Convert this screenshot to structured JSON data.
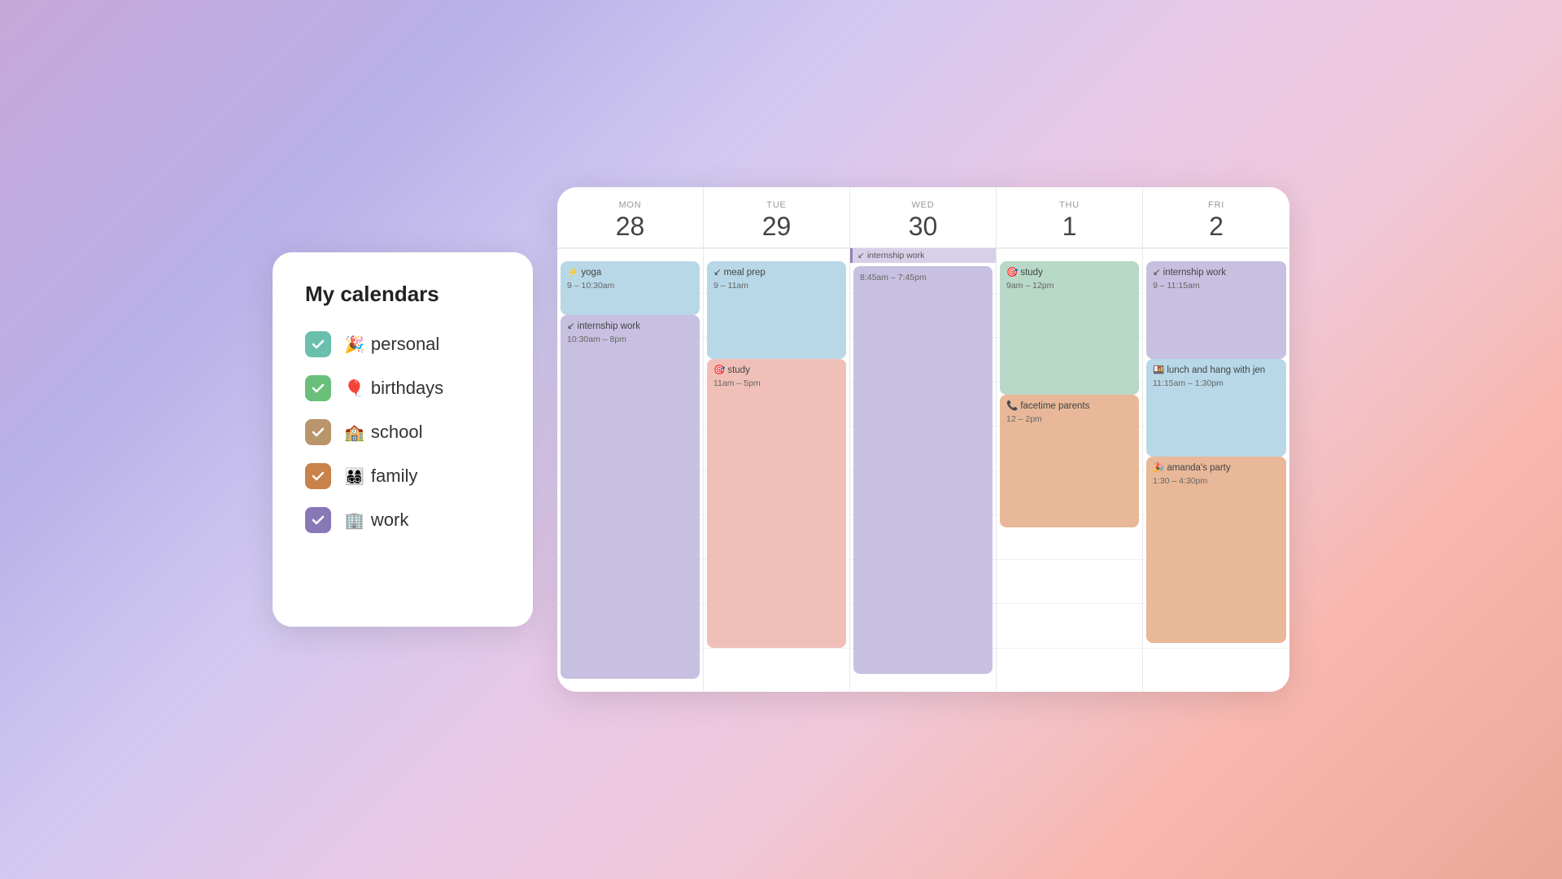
{
  "sidebar": {
    "title": "My calendars",
    "items": [
      {
        "id": "personal",
        "label": "personal",
        "emoji": "🎉",
        "color_class": "checkbox-teal",
        "checked": true
      },
      {
        "id": "birthdays",
        "label": "birthdays",
        "emoji": "🎈",
        "color_class": "checkbox-green",
        "checked": true
      },
      {
        "id": "school",
        "label": "school",
        "emoji": "🏫",
        "color_class": "checkbox-tan",
        "checked": true
      },
      {
        "id": "family",
        "label": "family",
        "emoji": "👨‍👩‍👧‍👦",
        "color_class": "checkbox-orange",
        "checked": true
      },
      {
        "id": "work",
        "label": "work",
        "emoji": "🏢",
        "color_class": "checkbox-purple",
        "checked": true
      }
    ]
  },
  "calendar": {
    "days": [
      {
        "name": "MON",
        "number": "28"
      },
      {
        "name": "TUE",
        "number": "29"
      },
      {
        "name": "WED",
        "number": "30"
      },
      {
        "name": "THU",
        "number": "1"
      },
      {
        "name": "FRI",
        "number": "2"
      }
    ],
    "events": {
      "mon": [
        {
          "title": "yoga",
          "emoji": "⚡",
          "time": "9 – 10:30am",
          "color": "event-blue",
          "top_pct": 3,
          "height_pct": 12
        },
        {
          "title": "internship work",
          "emoji": "↙",
          "time": "10:30am – 8pm",
          "color": "event-purple",
          "top_pct": 15,
          "height_pct": 82
        }
      ],
      "tue": [
        {
          "title": "meal prep",
          "emoji": "↙",
          "time": "9 – 11am",
          "color": "event-blue",
          "top_pct": 3,
          "height_pct": 22
        },
        {
          "title": "study",
          "emoji": "🎯",
          "time": "11am – 5pm",
          "color": "event-pink",
          "top_pct": 25,
          "height_pct": 65
        }
      ],
      "wed": [
        {
          "title": "internship work",
          "emoji": "↙",
          "time": "8:45am – 7:45pm",
          "color": "event-purple",
          "top_pct": 1,
          "height_pct": 96,
          "is_banner": true,
          "banner_text": "internship work",
          "banner_subtext": "8:45am – 7:45pm"
        }
      ],
      "thu": [
        {
          "title": "study",
          "emoji": "🎯",
          "time": "9am – 12pm",
          "color": "event-green",
          "top_pct": 3,
          "height_pct": 30
        },
        {
          "title": "facetime parents",
          "emoji": "📞",
          "time": "12 – 2pm",
          "color": "event-orange",
          "top_pct": 33,
          "height_pct": 30
        }
      ],
      "fri": [
        {
          "title": "internship work",
          "emoji": "↙",
          "time": "9 – 11:15am",
          "color": "event-purple",
          "top_pct": 3,
          "height_pct": 22
        },
        {
          "title": "lunch and hang with jen",
          "emoji": "🍱",
          "time": "11:15am – 1:30pm",
          "color": "event-blue",
          "top_pct": 25,
          "height_pct": 22
        },
        {
          "title": "amanda's party",
          "emoji": "🎉",
          "time": "1:30 – 4:30pm",
          "color": "event-orange",
          "top_pct": 47,
          "height_pct": 42
        }
      ]
    }
  }
}
